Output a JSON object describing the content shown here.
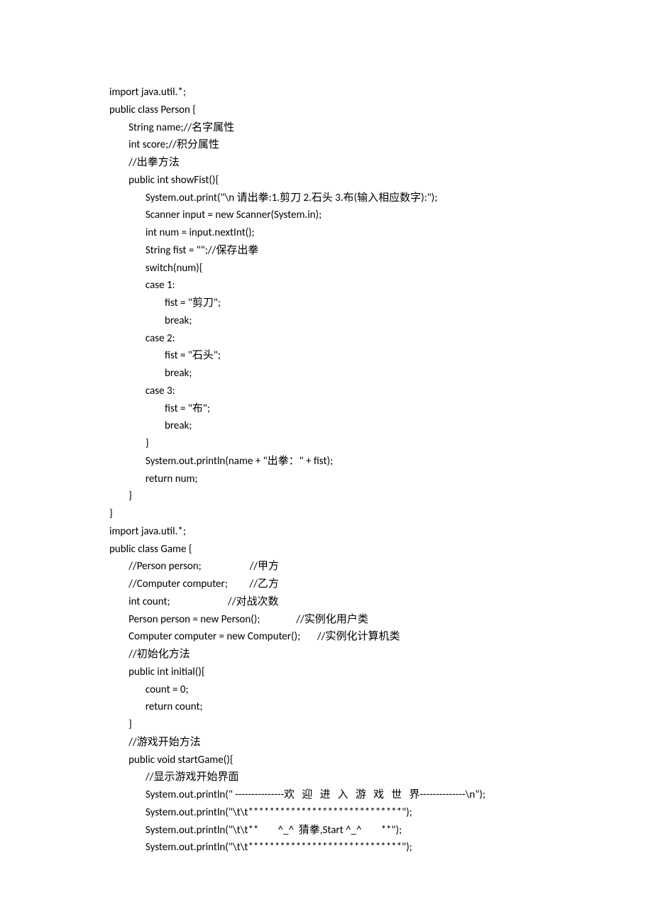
{
  "lines": [
    "import java.util.*;",
    "public class Person {",
    "        String name;//名字属性",
    "        int score;//积分属性",
    "        //出拳方法",
    "        public int showFist(){",
    "               System.out.print(\"\\n 请出拳:1.剪刀 2.石头 3.布(输入相应数字):\");",
    "               Scanner input = new Scanner(System.in);",
    "               int num = input.nextInt();",
    "               String fist = \"\";//保存出拳",
    "               switch(num){",
    "               case 1:",
    "                       fist = \"剪刀\";",
    "                       break;",
    "               case 2:",
    "                       fist = \"石头\";",
    "                       break;",
    "               case 3:",
    "                       fist = \"布\";",
    "                       break;",
    "               }",
    "               System.out.println(name + \"出拳：\" + fist);",
    "               return num;",
    "        }",
    "}",
    "import java.util.*;",
    "public class Game {",
    "        //Person person;                    //甲方",
    "        //Computer computer;         //乙方",
    "        int count;                        //对战次数",
    "        Person person = new Person();               //实例化用户类",
    "        Computer computer = new Computer();       //实例化计算机类",
    "        //初始化方法",
    "        public int initial(){",
    "               count = 0;",
    "               return count;",
    "        }",
    "        //游戏开始方法",
    "        public void startGame(){",
    "               //显示游戏开始界面",
    "               System.out.println(\" ---------------欢   迎   进   入   游   戏   世   界--------------\\n\");",
    "               System.out.println(\"\\t\\t*****************************\");",
    "               System.out.println(\"\\t\\t**        ^_^  猜拳,Start ^_^        **\");",
    "               System.out.println(\"\\t\\t*****************************\");"
  ]
}
